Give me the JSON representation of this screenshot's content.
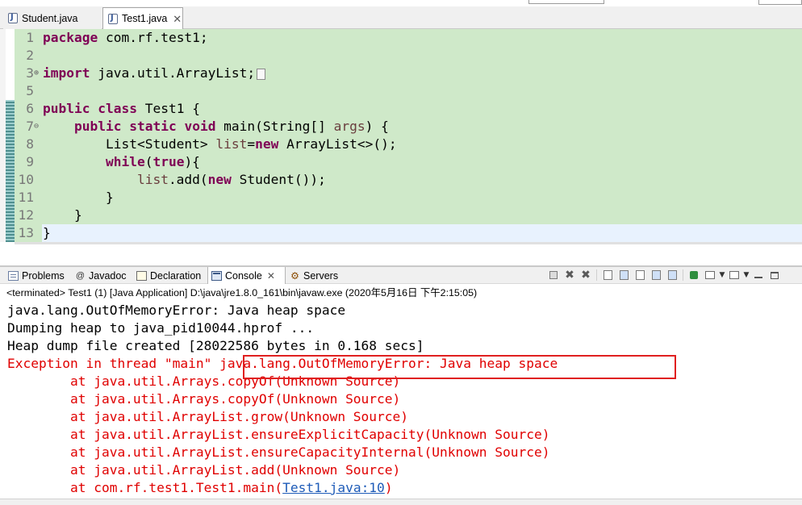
{
  "editor_tabs": [
    {
      "label": "Student.java",
      "icon": "java-file-icon",
      "active": false
    },
    {
      "label": "Test1.java",
      "icon": "java-file-icon",
      "active": true,
      "close": "✕"
    }
  ],
  "code": {
    "lines": [
      {
        "no": "1",
        "parts": [
          {
            "t": "package",
            "c": "kw"
          },
          {
            "t": " com.rf.test1;",
            "c": ""
          }
        ]
      },
      {
        "no": "2",
        "parts": []
      },
      {
        "no": "3",
        "fold": "⊕",
        "parts": [
          {
            "t": "import",
            "c": "kw"
          },
          {
            "t": " java.util.ArrayList;",
            "c": ""
          }
        ],
        "folded_box": true
      },
      {
        "no": "5",
        "parts": []
      },
      {
        "no": "6",
        "parts": [
          {
            "t": "public",
            "c": "kw"
          },
          {
            "t": " ",
            "c": ""
          },
          {
            "t": "class",
            "c": "kw"
          },
          {
            "t": " Test1 {",
            "c": ""
          }
        ]
      },
      {
        "no": "7",
        "fold": "⊖",
        "parts": [
          {
            "t": "    ",
            "c": ""
          },
          {
            "t": "public",
            "c": "kw"
          },
          {
            "t": " ",
            "c": ""
          },
          {
            "t": "static",
            "c": "kw"
          },
          {
            "t": " ",
            "c": ""
          },
          {
            "t": "void",
            "c": "kw"
          },
          {
            "t": " main(String[] ",
            "c": ""
          },
          {
            "t": "args",
            "c": "var"
          },
          {
            "t": ") {",
            "c": ""
          }
        ]
      },
      {
        "no": "8",
        "parts": [
          {
            "t": "        List<Student> ",
            "c": ""
          },
          {
            "t": "list",
            "c": "var"
          },
          {
            "t": "=",
            "c": ""
          },
          {
            "t": "new",
            "c": "kw"
          },
          {
            "t": " ArrayList<>();",
            "c": ""
          }
        ]
      },
      {
        "no": "9",
        "parts": [
          {
            "t": "        ",
            "c": ""
          },
          {
            "t": "while",
            "c": "kw"
          },
          {
            "t": "(",
            "c": ""
          },
          {
            "t": "true",
            "c": "kw"
          },
          {
            "t": "){",
            "c": ""
          }
        ]
      },
      {
        "no": "10",
        "parts": [
          {
            "t": "            ",
            "c": ""
          },
          {
            "t": "list",
            "c": "var"
          },
          {
            "t": ".add(",
            "c": ""
          },
          {
            "t": "new",
            "c": "kw"
          },
          {
            "t": " Student());",
            "c": ""
          }
        ]
      },
      {
        "no": "11",
        "parts": [
          {
            "t": "        }",
            "c": ""
          }
        ]
      },
      {
        "no": "12",
        "parts": [
          {
            "t": "    }",
            "c": ""
          }
        ]
      },
      {
        "no": "13",
        "parts": [
          {
            "t": "}",
            "c": ""
          }
        ]
      }
    ]
  },
  "panel_tabs": [
    {
      "label": "Problems",
      "icon": "problems-icon"
    },
    {
      "label": "Javadoc",
      "icon": "javadoc-icon"
    },
    {
      "label": "Declaration",
      "icon": "declaration-icon"
    },
    {
      "label": "Console",
      "icon": "console-icon",
      "active": true,
      "close": "✕"
    },
    {
      "label": "Servers",
      "icon": "servers-icon"
    }
  ],
  "console": {
    "status": "<terminated> Test1 (1) [Java Application] D:\\java\\jre1.8.0_161\\bin\\javaw.exe (2020年5月16日 下午2:15:05)",
    "lines": [
      {
        "text": "java.lang.OutOfMemoryError: Java heap space",
        "type": "std"
      },
      {
        "text": "Dumping heap to java_pid10044.hprof ...",
        "type": "std"
      },
      {
        "text": "Heap dump file created [28022586 bytes in 0.168 secs]",
        "type": "std"
      },
      {
        "text": "Exception in thread \"main\" java.lang.OutOfMemoryError: Java heap space",
        "type": "err"
      },
      {
        "text": "        at java.util.Arrays.copyOf(Unknown Source)",
        "type": "err"
      },
      {
        "text": "        at java.util.Arrays.copyOf(Unknown Source)",
        "type": "err"
      },
      {
        "text": "        at java.util.ArrayList.grow(Unknown Source)",
        "type": "err"
      },
      {
        "text": "        at java.util.ArrayList.ensureExplicitCapacity(Unknown Source)",
        "type": "err"
      },
      {
        "text": "        at java.util.ArrayList.ensureCapacityInternal(Unknown Source)",
        "type": "err"
      },
      {
        "text": "        at java.util.ArrayList.add(Unknown Source)",
        "type": "err"
      }
    ],
    "last_line": {
      "prefix": "        at com.rf.test1.Test1.main(",
      "link": "Test1.java:10",
      "suffix": ")"
    }
  },
  "colors": {
    "keyword": "#7f0055",
    "error": "#e00000",
    "link": "#1e5bb8",
    "highlight_box": "#e02020",
    "editor_bg": "#cfe9c9"
  }
}
